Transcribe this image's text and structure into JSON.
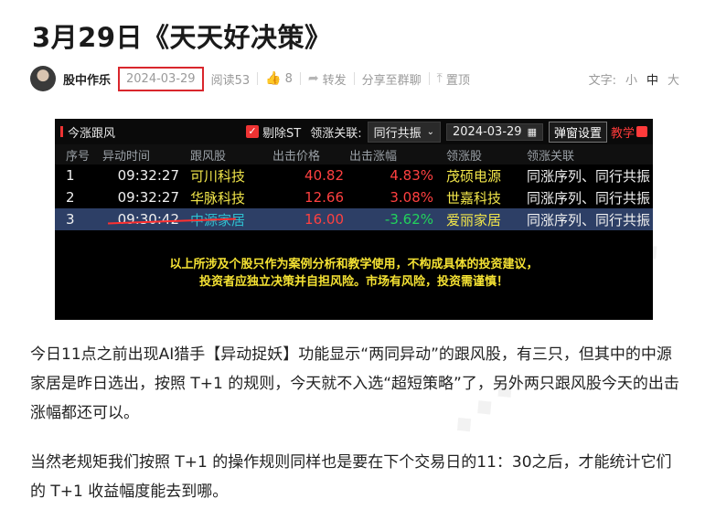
{
  "title": "3月29日《天天好决策》",
  "meta": {
    "author": "股中作乐",
    "date": "2024-03-29",
    "reads": "阅读53",
    "likes": "8",
    "share": "转发",
    "group_share": "分享至群聊",
    "top": "置顶",
    "text_size_label": "文字:",
    "text_small": "小",
    "text_medium": "中",
    "text_large": "大"
  },
  "panel": {
    "title": "今涨跟风",
    "exclude_st": "剔除ST",
    "lead_assoc_label": "领涨关联:",
    "lead_assoc_value": "同行共振",
    "date": "2024-03-29",
    "popup_settings": "弹窗设置",
    "teach": "教学",
    "columns": [
      "序号",
      "异动时间",
      "跟风股",
      "出击价格",
      "出击涨幅",
      "领涨股",
      "领涨关联"
    ],
    "rows": [
      {
        "no": "1",
        "time": "09:32:27",
        "stock": "可川科技",
        "price": "40.82",
        "pct": "4.83%",
        "lead": "茂硕电源",
        "relation": "同涨序列、同行共振"
      },
      {
        "no": "2",
        "time": "09:32:27",
        "stock": "华脉科技",
        "price": "12.66",
        "pct": "3.08%",
        "lead": "世嘉科技",
        "relation": "同涨序列、同行共振"
      },
      {
        "no": "3",
        "time": "09:30:42",
        "stock": "中源家居",
        "price": "16.00",
        "pct": "-3.62%",
        "lead": "爱丽家居",
        "relation": "同涨序列、同行共振"
      }
    ],
    "notice_line1": "以上所涉及个股只作为案例分析和教学使用，不构成具体的投资建议，",
    "notice_line2": "投资者应独立决策并自担风险。市场有风险，投资需谨慎！"
  },
  "body": {
    "para1": "今日11点之前出现AI猎手【异动捉妖】功能显示“两同异动”的跟风股，有三只，但其中的中源家居是昨日选出，按照 T+1 的规则，今天就不入选“超短策略”了，另外两只跟风股今天的出击涨幅都还可以。",
    "para2": "当然老规矩我们按照 T+1 的操作规则同样也是要在下个交易日的11：30之后，才能统计它们的 T+1 收益幅度能去到哪。"
  }
}
